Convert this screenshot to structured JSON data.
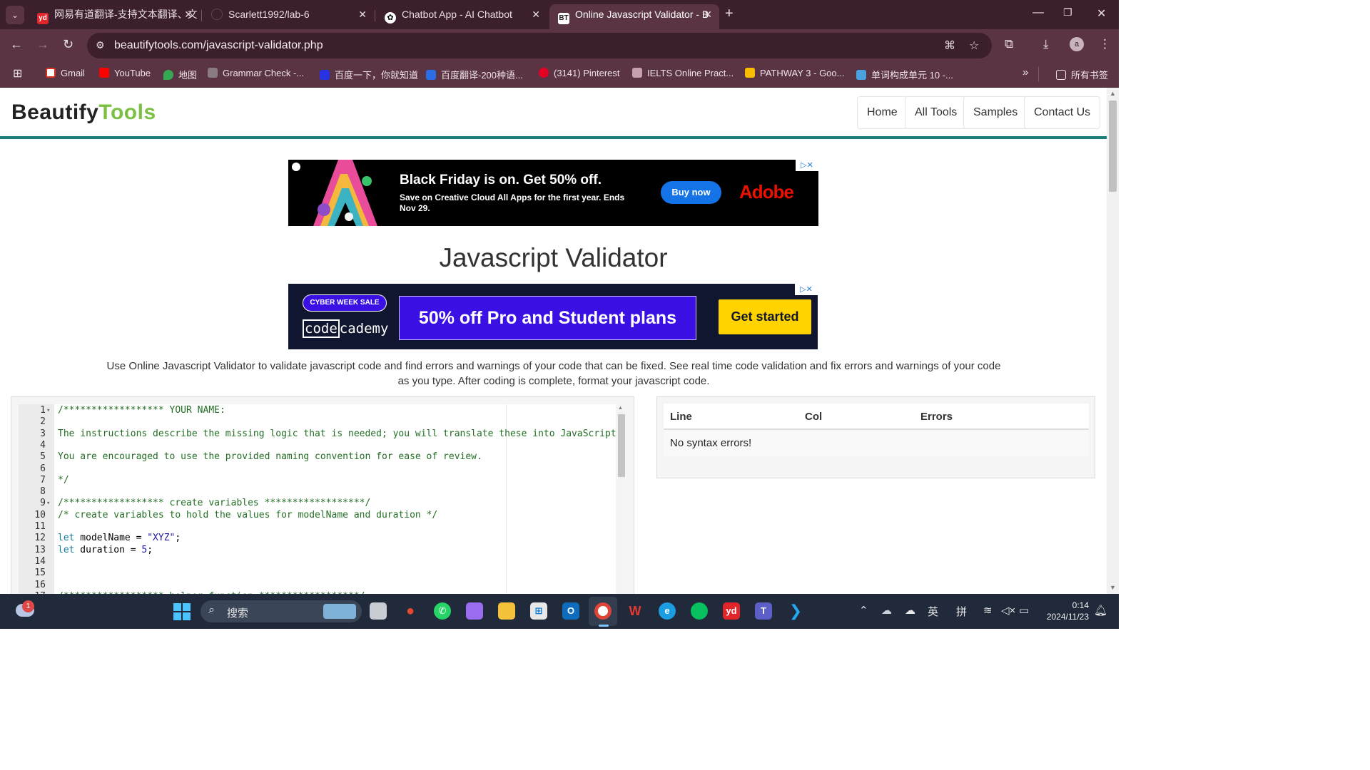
{
  "browser": {
    "tabs": [
      {
        "title": "网易有道翻译-支持文本翻译、文",
        "favicon": "youdao-icon"
      },
      {
        "title": "Scarlett1992/lab-6",
        "favicon": "github-icon"
      },
      {
        "title": "Chatbot App - AI Chatbot",
        "favicon": "chatbot-icon"
      },
      {
        "title": "Online Javascript Validator - B",
        "favicon": "beautifytools-icon",
        "active": true
      }
    ],
    "url": "beautifytools.com/javascript-validator.php",
    "profile_initial": "a",
    "bookmarks": [
      {
        "label": "Gmail",
        "icon": "gmail-icon"
      },
      {
        "label": "YouTube",
        "icon": "youtube-icon"
      },
      {
        "label": "地图",
        "icon": "maps-icon"
      },
      {
        "label": "Grammar Check -...",
        "icon": "grammar-icon"
      },
      {
        "label": "百度一下，你就知道",
        "icon": "baidu-icon"
      },
      {
        "label": "百度翻译-200种语...",
        "icon": "baidu-translate-icon"
      },
      {
        "label": "(3141) Pinterest",
        "icon": "pinterest-icon"
      },
      {
        "label": "IELTS Online Pract...",
        "icon": "ielts-icon"
      },
      {
        "label": "PATHWAY 3 - Goo...",
        "icon": "drive-icon"
      },
      {
        "label": "单词构成单元 10 -...",
        "icon": "word-icon"
      }
    ],
    "all_bookmarks_label": "所有书签"
  },
  "site": {
    "logo_part1": "Beautify",
    "logo_part2": "Tools",
    "nav": [
      "Home",
      "All Tools",
      "Samples",
      "Contact Us"
    ]
  },
  "ad1": {
    "headline": "Black Friday is on. Get 50% off.",
    "sub": "Save on Creative Cloud All Apps for the first year. Ends Nov 29.",
    "button": "Buy now",
    "brand": "Adobe"
  },
  "page_title": "Javascript Validator",
  "ad2": {
    "badge": "CYBER WEEK SALE",
    "brand_box": "code",
    "brand_rest": "cademy",
    "headline": "50% off Pro and Student plans",
    "cta": "Get started"
  },
  "description": "Use Online Javascript Validator to validate javascript code and find errors and warnings of your code that can be fixed. See real time code validation and fix errors and warnings of your code as you type. After coding is complete, format your javascript code.",
  "editor": {
    "lines": [
      {
        "n": "1",
        "fold": true,
        "parts": [
          {
            "t": "/****************** YOUR NAME:",
            "c": "com"
          }
        ]
      },
      {
        "n": "2",
        "parts": []
      },
      {
        "n": "3",
        "parts": [
          {
            "t": "The instructions describe the missing logic that is needed; you will translate these into JavaScript",
            "c": "com"
          }
        ]
      },
      {
        "n": "4",
        "parts": []
      },
      {
        "n": "5",
        "parts": [
          {
            "t": "You are encouraged to use the provided naming convention for ease of review.",
            "c": "com"
          }
        ]
      },
      {
        "n": "6",
        "parts": []
      },
      {
        "n": "7",
        "parts": [
          {
            "t": "*/",
            "c": "com"
          }
        ]
      },
      {
        "n": "8",
        "parts": []
      },
      {
        "n": "9",
        "fold": true,
        "parts": [
          {
            "t": "/****************** create variables ******************/",
            "c": "com"
          }
        ]
      },
      {
        "n": "10",
        "parts": [
          {
            "t": "/* create variables to hold the values for modelName and duration */",
            "c": "com"
          }
        ]
      },
      {
        "n": "11",
        "parts": []
      },
      {
        "n": "12",
        "parts": [
          {
            "t": "let",
            "c": "kw"
          },
          {
            "t": " modelName = ",
            "c": "plain"
          },
          {
            "t": "\"XYZ\"",
            "c": "str"
          },
          {
            "t": ";",
            "c": "plain"
          }
        ]
      },
      {
        "n": "13",
        "parts": [
          {
            "t": "let",
            "c": "kw"
          },
          {
            "t": " duration = ",
            "c": "plain"
          },
          {
            "t": "5",
            "c": "str"
          },
          {
            "t": ";",
            "c": "plain"
          }
        ]
      },
      {
        "n": "14",
        "parts": []
      },
      {
        "n": "15",
        "parts": []
      },
      {
        "n": "16",
        "parts": []
      },
      {
        "n": "17",
        "fold": true,
        "parts": [
          {
            "t": "/****************** helper function ******************/",
            "c": "com"
          }
        ]
      }
    ]
  },
  "results": {
    "headers": [
      "Line",
      "Col",
      "Errors"
    ],
    "message": "No syntax errors!"
  },
  "taskbar": {
    "search_placeholder": "搜索",
    "notification_count": "1",
    "ime_lang": "英",
    "ime_mode": "拼",
    "time": "0:14",
    "date": "2024/11/23"
  }
}
